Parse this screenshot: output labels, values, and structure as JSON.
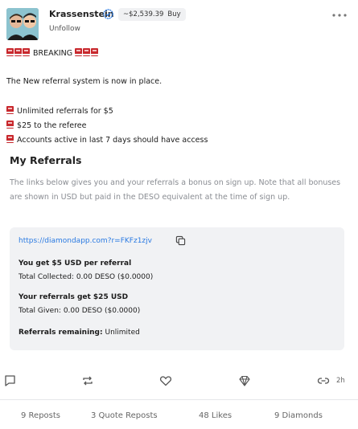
{
  "header": {
    "username": "Krassenstein",
    "price": "~$2,539.39",
    "buy_label": "Buy",
    "unfollow_label": "Unfollow"
  },
  "post": {
    "breaking": "BREAKING",
    "announcement": "The New referral system is now in place.",
    "bullets": [
      "Unlimited referrals for $5",
      "$25 to the referee",
      "Accounts active in last 7 days should have access"
    ]
  },
  "referrals": {
    "title": "My Referrals",
    "description": "The links below gives you and your referrals a bonus on sign up. Note that all bonuses are shown in USD but paid in the DESO equivalent at the time of sign up.",
    "link": "https://diamondapp.com?r=FKFz1zjv",
    "you_get_title": "You get $5 USD per referral",
    "total_collected": "Total Collected: 0.00 DESO ($0.0000)",
    "they_get_title": "Your referrals get $25 USD",
    "total_given": "Total Given: 0.00 DESO ($0.0000)",
    "remaining_label": "Referrals remaining:",
    "remaining_value": "Unlimited"
  },
  "actions": {
    "time": "2h",
    "icons": [
      "comment-icon",
      "repost-icon",
      "heart-icon",
      "diamond-icon",
      "link-icon"
    ]
  },
  "stats": {
    "reposts": "9 Reposts",
    "quote_reposts": "3 Quote Reposts",
    "likes": "48 Likes",
    "diamonds": "9 Diamonds"
  },
  "colors": {
    "link": "#2a7ae2",
    "verified": "#2a7ae2",
    "book_red": "#c8282d",
    "muted_text": "#8a8d93",
    "box_bg": "#f1f2f4"
  }
}
